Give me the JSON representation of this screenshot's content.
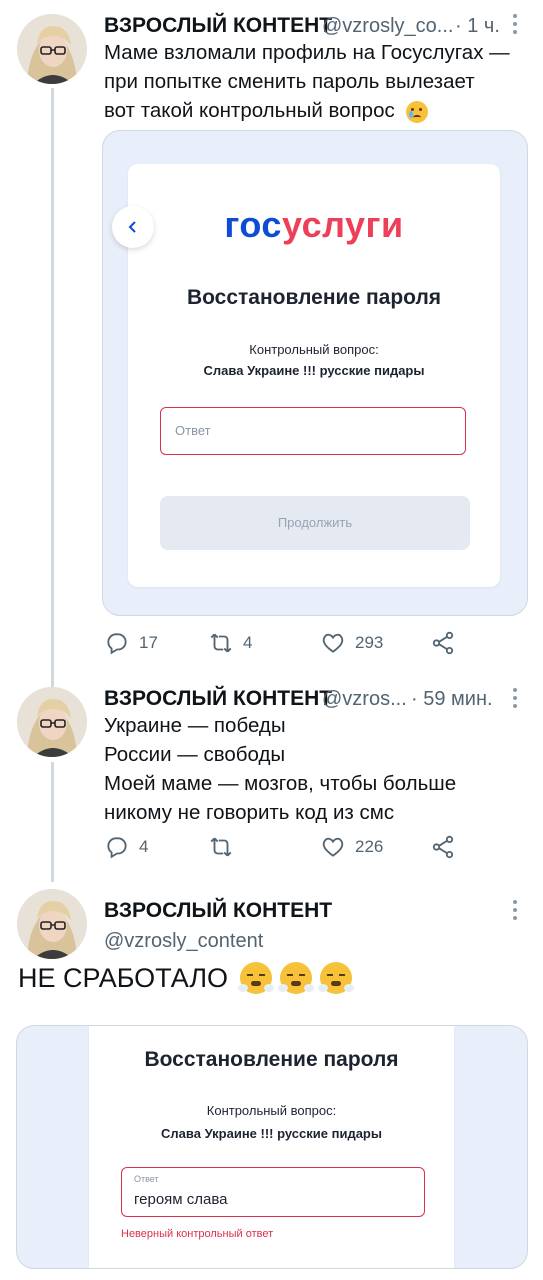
{
  "tweets": [
    {
      "author": "ВЗРОСЛЫЙ КОНТЕНТ",
      "handle": "@vzrosly_co...",
      "time": "· 1 ч.",
      "text_lines": [
        "Маме взломали профиль на Госуслугах —",
        "при попытке сменить пароль вылезает",
        "вот такой контрольный вопрос"
      ],
      "emoji": "😢",
      "actions": {
        "replies": "17",
        "retweets": "4",
        "likes": "293"
      }
    },
    {
      "author": "ВЗРОСЛЫЙ КОНТЕНТ",
      "handle": "@vzros...",
      "time": "· 59 мин.",
      "text_lines": [
        "Украине — победы",
        "России — свободы",
        "Моей маме — мозгов, чтобы больше",
        "никому не говорить код из смс"
      ],
      "actions": {
        "replies": "4",
        "retweets": "",
        "likes": "226"
      }
    },
    {
      "author": "ВЗРОСЛЫЙ КОНТЕНТ",
      "handle": "@vzrosly_content",
      "text": "НЕ СРАБОТАЛО",
      "emojis": "😤😤😤"
    }
  ],
  "gosuslugi_card": {
    "logo_part1": "гос",
    "logo_part2": "услуги",
    "title": "Восстановление пароля",
    "question_label": "Контрольный вопрос:",
    "question": "Слава Украине !!! русские пидары",
    "answer_placeholder": "Ответ",
    "continue_button": "Продолжить",
    "logo_blue": "#0d4cd3",
    "logo_red": "#ee3f58"
  },
  "second_card": {
    "title": "Восстановление пароля",
    "question_label": "Контрольный вопрос:",
    "question": "Слава Украине !!! русские пидары",
    "answer_label": "Ответ",
    "answer_value": "героям слава",
    "error": "Неверный контрольный ответ",
    "error_color": "#d9304b"
  }
}
